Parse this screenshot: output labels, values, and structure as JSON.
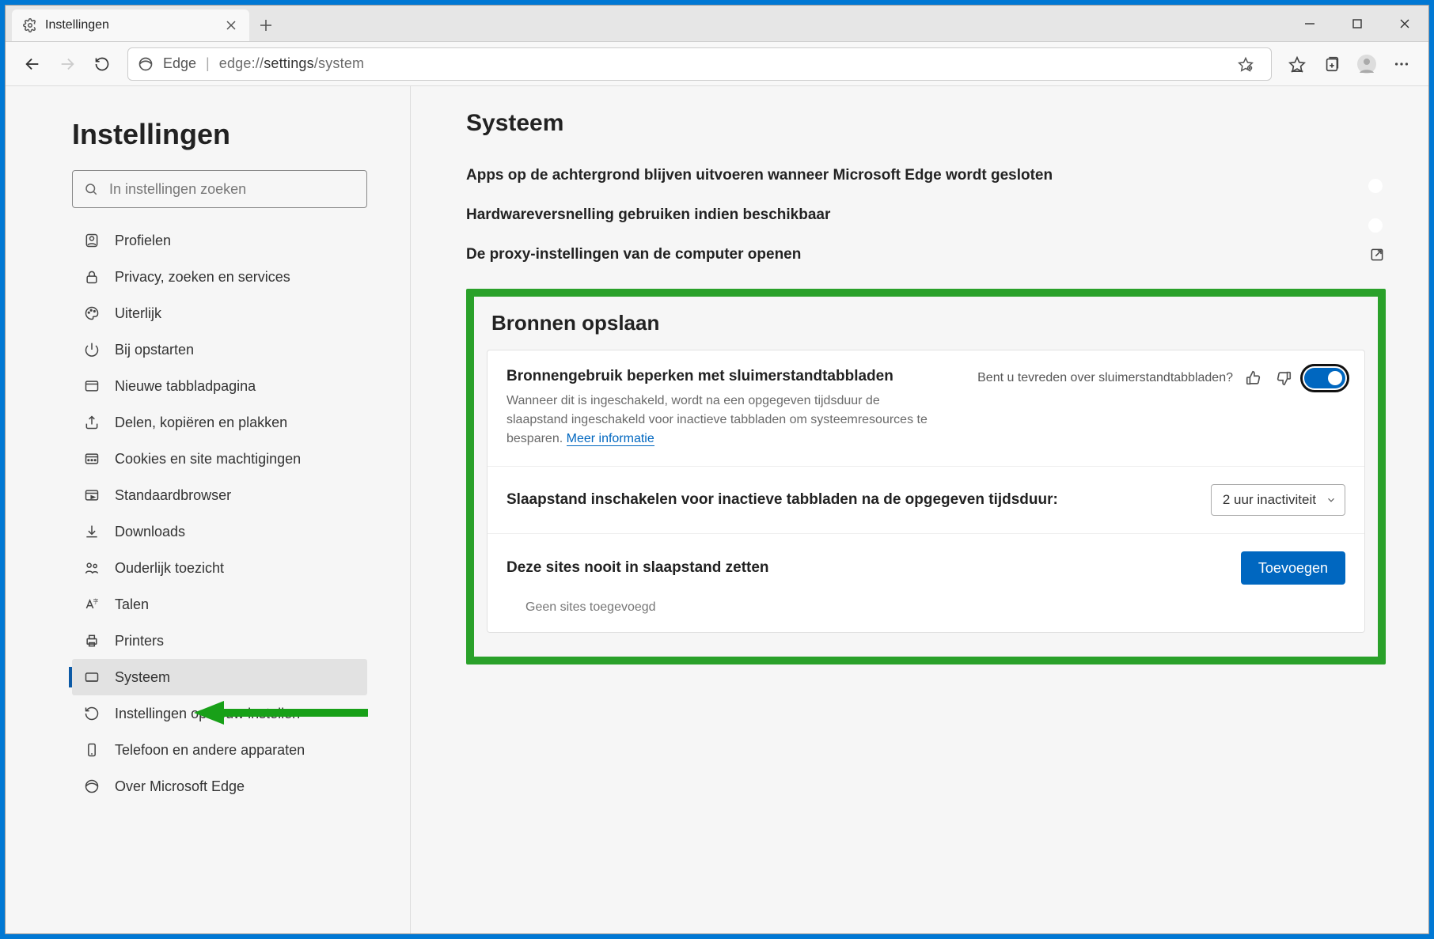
{
  "window": {
    "tab_title": "Instellingen",
    "newtab_aria": "Nieuw tabblad"
  },
  "toolbar": {
    "brand": "Edge",
    "url_prefix": "edge://",
    "url_strong": "settings",
    "url_suffix": "/system"
  },
  "sidebar": {
    "heading": "Instellingen",
    "search_placeholder": "In instellingen zoeken",
    "items": [
      {
        "id": "profiles",
        "label": "Profielen"
      },
      {
        "id": "privacy",
        "label": "Privacy, zoeken en services"
      },
      {
        "id": "appearance",
        "label": "Uiterlijk"
      },
      {
        "id": "startup",
        "label": "Bij opstarten"
      },
      {
        "id": "newtab",
        "label": "Nieuwe tabbladpagina"
      },
      {
        "id": "share",
        "label": "Delen, kopiëren en plakken"
      },
      {
        "id": "cookies",
        "label": "Cookies en site machtigingen"
      },
      {
        "id": "default",
        "label": "Standaardbrowser"
      },
      {
        "id": "downloads",
        "label": "Downloads"
      },
      {
        "id": "family",
        "label": "Ouderlijk toezicht"
      },
      {
        "id": "languages",
        "label": "Talen"
      },
      {
        "id": "printers",
        "label": "Printers"
      },
      {
        "id": "system",
        "label": "Systeem"
      },
      {
        "id": "reset",
        "label": "Instellingen opnieuw instellen"
      },
      {
        "id": "phone",
        "label": "Telefoon en andere apparaten"
      },
      {
        "id": "about",
        "label": "Over Microsoft Edge"
      }
    ]
  },
  "main": {
    "heading": "Systeem",
    "settings": [
      {
        "id": "background_apps",
        "label": "Apps op de achtergrond blijven uitvoeren wanneer Microsoft Edge wordt gesloten",
        "enabled": true
      },
      {
        "id": "hw_accel",
        "label": "Hardwareversnelling gebruiken indien beschikbaar",
        "enabled": true
      },
      {
        "id": "proxy",
        "label": "De proxy-instellingen van de computer openen",
        "type": "link"
      }
    ],
    "resources": {
      "heading": "Bronnen opslaan",
      "sleeping": {
        "title": "Bronnengebruik beperken met sluimerstandtabbladen",
        "desc": "Wanneer dit is ingeschakeld, wordt na een opgegeven tijdsduur de slaapstand ingeschakeld voor inactieve tabbladen om systeemresources te besparen. ",
        "more": "Meer informatie",
        "feedback_q": "Bent u tevreden over sluimerstandtabbladen?",
        "enabled": true
      },
      "timeout": {
        "label": "Slaapstand inschakelen voor inactieve tabbladen na de opgegeven tijdsduur:",
        "value": "2 uur inactiviteit"
      },
      "never": {
        "label": "Deze sites nooit in slaapstand zetten",
        "add": "Toevoegen",
        "empty": "Geen sites toegevoegd"
      }
    }
  }
}
